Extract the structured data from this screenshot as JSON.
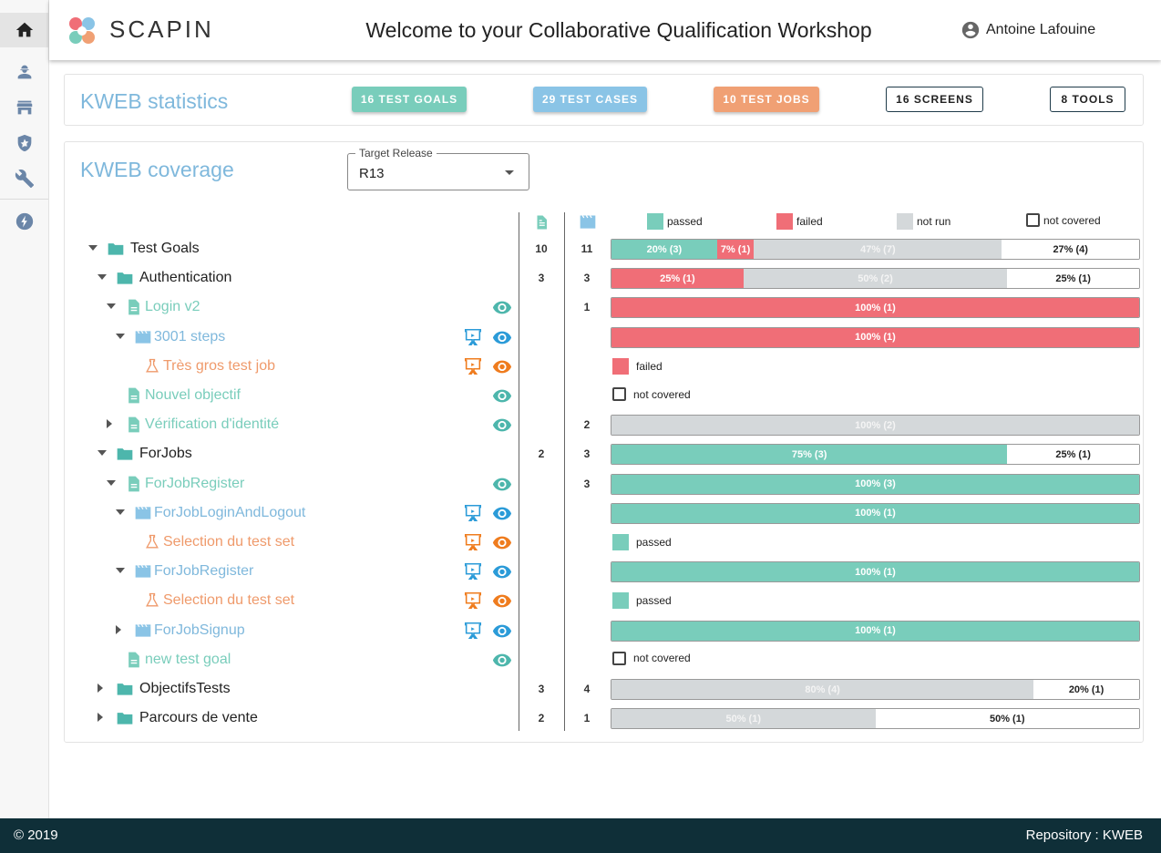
{
  "colors": {
    "passed": "#79cdbb",
    "failed": "#f06e77",
    "not_run": "#d4d8da",
    "goal": "#79cdbb",
    "case": "#7fb8dc",
    "job": "#ef9a6b",
    "footer": "#0f2f38"
  },
  "rail": {
    "items": [
      {
        "name": "home-icon"
      },
      {
        "name": "worker-icon"
      },
      {
        "name": "store-icon"
      },
      {
        "name": "badge-icon"
      },
      {
        "name": "wrench-icon"
      },
      {
        "name": "lightning-icon"
      }
    ]
  },
  "header": {
    "logo_text": "SCAPIN",
    "welcome": "Welcome to your Collaborative Qualification Workshop",
    "user_name": "Antoine Lafouine"
  },
  "stats": {
    "title": "KWEB statistics",
    "chips": [
      {
        "label": "16 TEST GOALS",
        "style": "filled",
        "color": "#79cdbb"
      },
      {
        "label": "29 TEST CASES",
        "style": "filled",
        "color": "#8ac4e6"
      },
      {
        "label": "10 TEST JOBS",
        "style": "filled",
        "color": "#f0a074"
      },
      {
        "label": "16 SCREENS",
        "style": "outline"
      },
      {
        "label": "8 TOOLS",
        "style": "outline"
      }
    ]
  },
  "coverage": {
    "title": "KWEB coverage",
    "release_label": "Target Release",
    "release_value": "R13",
    "legend": {
      "passed": "passed",
      "failed": "failed",
      "not_run": "not run",
      "not_covered": "not covered"
    },
    "rows": [
      {
        "label": "Test Goals",
        "kind": "folder",
        "indent": 0,
        "arrow": "down",
        "goals": "10",
        "cases": "11",
        "bar": [
          {
            "t": "passed",
            "v": 20,
            "text": "20% (3)"
          },
          {
            "t": "failed",
            "v": 7,
            "text": "7% (1)"
          },
          {
            "t": "notrun",
            "v": 47,
            "text": "47% (7)"
          },
          {
            "t": "notcov",
            "v": 26,
            "text": "27% (4)"
          }
        ]
      },
      {
        "label": "Authentication",
        "kind": "folder",
        "indent": 1,
        "arrow": "down",
        "goals": "3",
        "cases": "3",
        "bar": [
          {
            "t": "failed",
            "v": 25,
            "text": "25% (1)"
          },
          {
            "t": "notrun",
            "v": 50,
            "text": "50% (2)"
          },
          {
            "t": "notcov",
            "v": 25,
            "text": "25% (1)"
          }
        ]
      },
      {
        "label": "Login v2",
        "kind": "goal",
        "indent": 2,
        "arrow": "down",
        "cases": "1",
        "actions": [
          "eye"
        ],
        "bar": [
          {
            "t": "failed",
            "v": 100,
            "text": "100% (1)"
          }
        ]
      },
      {
        "label": "3001 steps",
        "kind": "case",
        "indent": 3,
        "arrow": "down",
        "actions": [
          "present",
          "eye"
        ],
        "bar": [
          {
            "t": "failed",
            "v": 100,
            "text": "100% (1)"
          }
        ]
      },
      {
        "label": "Très gros test job",
        "kind": "job",
        "indent": 4,
        "actions": [
          "present",
          "eye"
        ],
        "status": {
          "t": "failed",
          "text": "failed"
        }
      },
      {
        "label": "Nouvel objectif",
        "kind": "goal",
        "indent": 2,
        "actions": [
          "eye"
        ],
        "status": {
          "t": "notcov",
          "text": "not covered"
        }
      },
      {
        "label": "Vérification d'identité",
        "kind": "goal",
        "indent": 2,
        "arrow": "right",
        "cases": "2",
        "actions": [
          "eye"
        ],
        "bar": [
          {
            "t": "notrun",
            "v": 100,
            "text": "100% (2)"
          }
        ]
      },
      {
        "label": "ForJobs",
        "kind": "folder",
        "indent": 1,
        "arrow": "down",
        "goals": "2",
        "cases": "3",
        "bar": [
          {
            "t": "passed",
            "v": 75,
            "text": "75% (3)"
          },
          {
            "t": "notcov",
            "v": 25,
            "text": "25% (1)"
          }
        ]
      },
      {
        "label": "ForJobRegister",
        "kind": "goal",
        "indent": 2,
        "arrow": "down",
        "cases": "3",
        "actions": [
          "eye"
        ],
        "bar": [
          {
            "t": "passed",
            "v": 100,
            "text": "100% (3)"
          }
        ]
      },
      {
        "label": "ForJobLoginAndLogout",
        "kind": "case",
        "indent": 3,
        "arrow": "down",
        "actions": [
          "present",
          "eye"
        ],
        "bar": [
          {
            "t": "passed",
            "v": 100,
            "text": "100% (1)"
          }
        ]
      },
      {
        "label": "Selection du test set",
        "kind": "job",
        "indent": 4,
        "actions": [
          "present",
          "eye"
        ],
        "status": {
          "t": "passed",
          "text": "passed"
        }
      },
      {
        "label": "ForJobRegister",
        "kind": "case",
        "indent": 3,
        "arrow": "down",
        "actions": [
          "present",
          "eye"
        ],
        "bar": [
          {
            "t": "passed",
            "v": 100,
            "text": "100% (1)"
          }
        ]
      },
      {
        "label": "Selection du test set",
        "kind": "job",
        "indent": 4,
        "actions": [
          "present",
          "eye"
        ],
        "status": {
          "t": "passed",
          "text": "passed"
        }
      },
      {
        "label": "ForJobSignup",
        "kind": "case",
        "indent": 3,
        "arrow": "right",
        "actions": [
          "present",
          "eye"
        ],
        "bar": [
          {
            "t": "passed",
            "v": 100,
            "text": "100% (1)"
          }
        ]
      },
      {
        "label": "new test goal",
        "kind": "goal",
        "indent": 2,
        "actions": [
          "eye"
        ],
        "status": {
          "t": "notcov",
          "text": "not covered"
        }
      },
      {
        "label": "ObjectifsTests",
        "kind": "folder",
        "indent": 1,
        "arrow": "right",
        "goals": "3",
        "cases": "4",
        "bar": [
          {
            "t": "notrun",
            "v": 80,
            "text": "80% (4)"
          },
          {
            "t": "notcov",
            "v": 20,
            "text": "20% (1)"
          }
        ]
      },
      {
        "label": "Parcours de vente",
        "kind": "folder",
        "indent": 1,
        "arrow": "right",
        "goals": "2",
        "cases": "1",
        "bar": [
          {
            "t": "notrun",
            "v": 50,
            "text": "50% (1)"
          },
          {
            "t": "notcov",
            "v": 50,
            "text": "50% (1)"
          }
        ]
      }
    ]
  },
  "footer": {
    "copyright": "© 2019",
    "repository": "Repository : KWEB"
  }
}
